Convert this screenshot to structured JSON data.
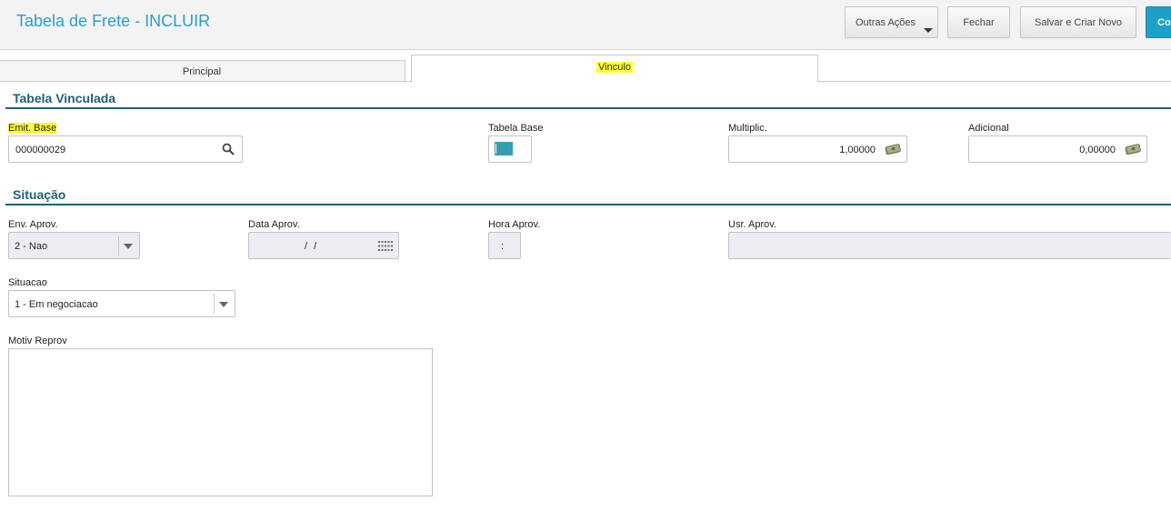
{
  "header": {
    "title": "Tabela de Frete - INCLUIR",
    "buttons": {
      "outras_acoes": "Outras Ações",
      "fechar": "Fechar",
      "salvar_criar_novo": "Salvar e Criar Novo",
      "confirmar": "Co"
    }
  },
  "tabs": [
    {
      "label": "Principal",
      "active": false
    },
    {
      "label": "Vinculo",
      "active": true
    }
  ],
  "tabela_vinculada": {
    "title": "Tabela Vinculada",
    "emit_base": {
      "label": "Emit. Base",
      "value": "000000029",
      "icon": "search-icon"
    },
    "tabela_base": {
      "label": "Tabela Base",
      "value": ""
    },
    "multiplic": {
      "label": "Multiplic.",
      "value": "1,00000",
      "icon": "money-icon"
    },
    "adicional": {
      "label": "Adicional",
      "value": "0,00000",
      "icon": "money-icon"
    }
  },
  "situacao_section": {
    "title": "Situação",
    "env_aprov": {
      "label": "Env. Aprov.",
      "value": "2 - Nao"
    },
    "data_aprov": {
      "label": "Data Aprov.",
      "value": "/ /",
      "icon": "calendar-icon"
    },
    "hora_aprov": {
      "label": "Hora Aprov.",
      "value": ":"
    },
    "usr_aprov": {
      "label": "Usr. Aprov.",
      "value": ""
    },
    "situacao": {
      "label": "Situacao",
      "value": "1 - Em negociacao"
    },
    "motiv_reprov": {
      "label": "Motiv Reprov",
      "value": ""
    }
  },
  "colors": {
    "accent": "#2a9fc8",
    "section": "#1f5f7a",
    "highlight": "#ffff33",
    "primary_button": "#1e9fc7"
  }
}
